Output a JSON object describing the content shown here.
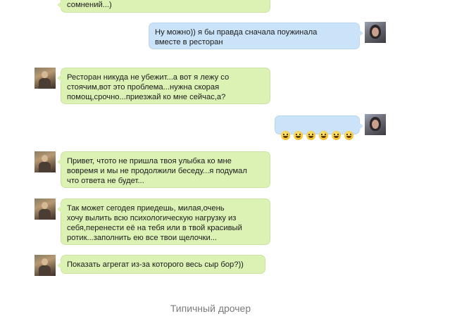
{
  "messages": [
    {
      "from": "in",
      "text": "сомнений...)"
    },
    {
      "from": "out",
      "text": "Ну можно)) я бы правда сначала поужинала\nвместе в ресторан"
    },
    {
      "from": "in",
      "text": "Ресторан никуда не убежит...а вот я лежу со\nстоячим,вот это проблема...нужна скорая\nпомощ,срочно...приезжай ко мне сейчас,а?"
    },
    {
      "from": "out",
      "text": "",
      "emoji": [
        "smile-emoji",
        "smile-emoji",
        "smile-emoji",
        "smile-emoji",
        "smile-emoji",
        "smile-emoji"
      ]
    },
    {
      "from": "in",
      "text": "Привет, чтото не пришла твоя улыбка ко мне\nвовремя и мы не продолжили беседу...я подумал\nчто ответа не будет..."
    },
    {
      "from": "in",
      "text": "Так может сегодея приедешь, милая,очень\nхочу вылить всю психологическую нагрузку из\nсебя,перенести её на тебя или в твой красивый\nротик...заполнить ею все твои щелочки..."
    },
    {
      "from": "in",
      "text": "Показать агрегат из-за которого весь сыр бор?))"
    }
  ],
  "caption": "Типичный дрочер",
  "colors": {
    "incoming_bubble": "#dcf2b5",
    "outgoing_bubble": "#cbe3f8",
    "caption_text": "#7b7b7b"
  }
}
